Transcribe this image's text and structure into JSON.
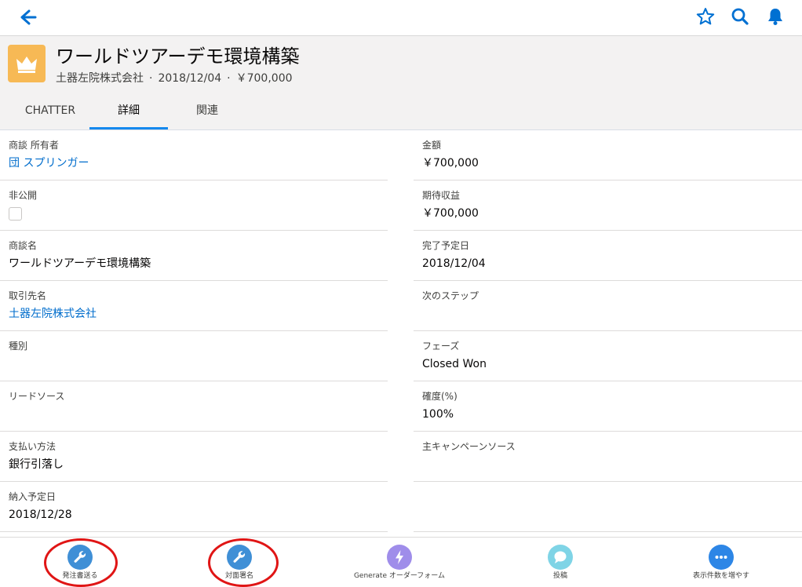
{
  "colors": {
    "accent": "#1589ee",
    "link": "#006dcc",
    "record_icon": "#f7b955",
    "action_blue": "#3f8fd6",
    "action_purple": "#9f8dea",
    "action_teal": "#7fd4e6",
    "action_more": "#2d86e6",
    "annotation_red": "#e01515"
  },
  "topbar": {
    "back_icon": "back-arrow-icon",
    "icons": [
      "star-icon",
      "search-icon",
      "bell-icon"
    ]
  },
  "record": {
    "icon": "crown-icon",
    "title": "ワールドツアーデモ環境構築",
    "account": "土器左院株式会社",
    "close_date": "2018/12/04",
    "amount": "￥700,000"
  },
  "tabs": [
    {
      "label": "CHATTER"
    },
    {
      "label": "詳細"
    },
    {
      "label": "関連"
    }
  ],
  "active_tab": "詳細",
  "fields_left": [
    {
      "label": "商談 所有者",
      "value": "団 スプリンガー",
      "link": true
    },
    {
      "label": "非公開",
      "value": "",
      "checkbox": true,
      "checked": false
    },
    {
      "label": "商談名",
      "value": "ワールドツアーデモ環境構築"
    },
    {
      "label": "取引先名",
      "value": "土器左院株式会社",
      "link": true
    },
    {
      "label": "種別",
      "value": ""
    },
    {
      "label": "リードソース",
      "value": ""
    },
    {
      "label": "支払い方法",
      "value": "銀行引落し"
    },
    {
      "label": "納入予定日",
      "value": "2018/12/28"
    }
  ],
  "fields_right": [
    {
      "label": "金額",
      "value": "￥700,000"
    },
    {
      "label": "期待収益",
      "value": "￥700,000"
    },
    {
      "label": "完了予定日",
      "value": "2018/12/04"
    },
    {
      "label": "次のステップ",
      "value": ""
    },
    {
      "label": "フェーズ",
      "value": "Closed Won"
    },
    {
      "label": "確度(%)",
      "value": "100%"
    },
    {
      "label": "主キャンペーンソース",
      "value": ""
    }
  ],
  "actions": [
    {
      "label": "発注書送る",
      "icon": "wrench-icon"
    },
    {
      "label": "対面署名",
      "icon": "wrench-icon"
    },
    {
      "label": "Generate オーダーフォーム",
      "icon": "lightning-icon"
    },
    {
      "label": "投稿",
      "icon": "chat-bubble-icon"
    },
    {
      "label": "表示件数を増やす",
      "icon": "more-icon"
    }
  ]
}
